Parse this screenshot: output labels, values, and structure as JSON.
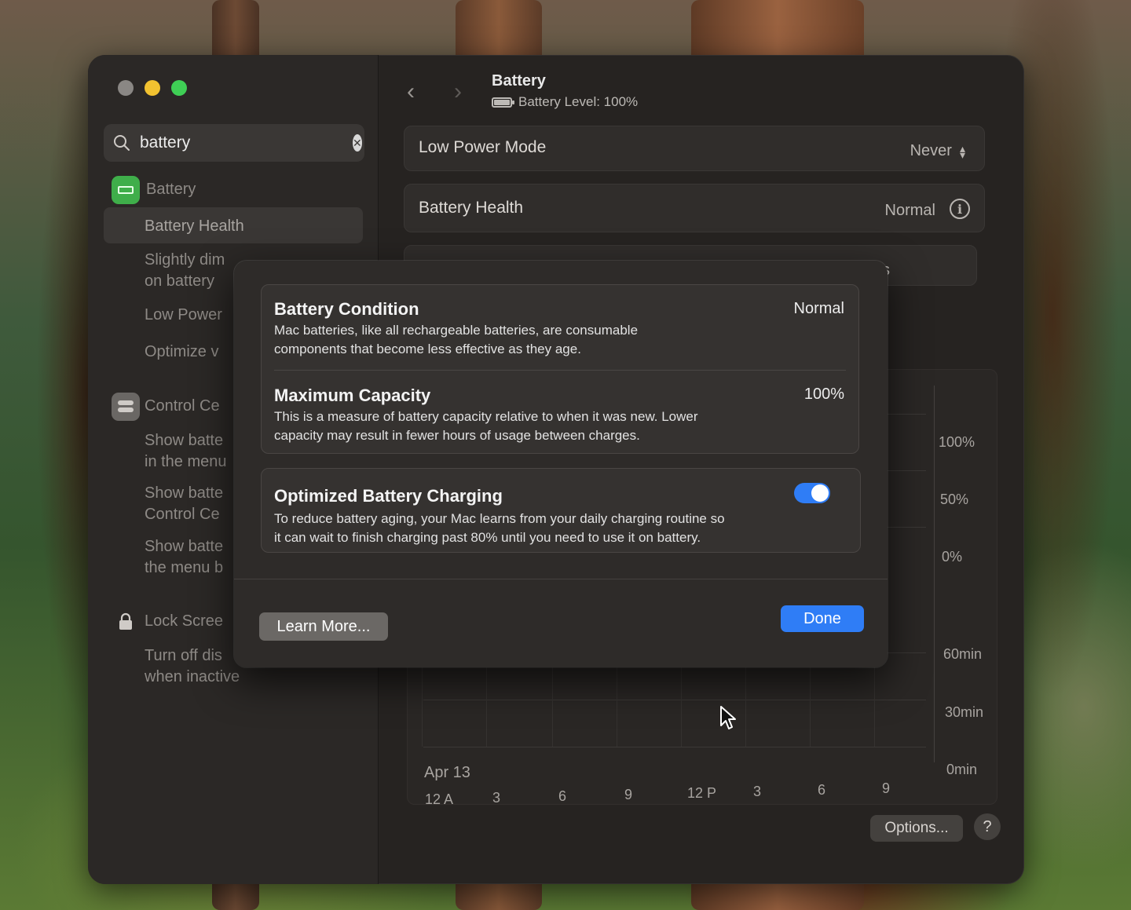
{
  "sidebar": {
    "search": {
      "value": "battery"
    },
    "results": [
      {
        "label": "Battery"
      },
      {
        "label": "Battery Health"
      },
      {
        "label_line1": "Slightly dim",
        "label_line2": "on battery"
      },
      {
        "label": "Low Power"
      },
      {
        "label": "Optimize v"
      },
      {
        "label": "Control Ce"
      },
      {
        "label_line1": "Show batte",
        "label_line2": "in the menu"
      },
      {
        "label_line1": "Show batte",
        "label_line2": "Control Ce"
      },
      {
        "label_line1": "Show batte",
        "label_line2": "the menu b"
      },
      {
        "label": "Lock Scree"
      },
      {
        "label_line1": "Turn off dis",
        "label_line2": "when inactive"
      }
    ]
  },
  "header": {
    "title": "Battery",
    "subtitle": "Battery Level: 100%"
  },
  "settings": {
    "low_power_mode": {
      "label": "Low Power Mode",
      "value": "Never"
    },
    "battery_health": {
      "label": "Battery Health",
      "value": "Normal"
    },
    "hidden_row_fragment": "s"
  },
  "chart": {
    "level_ticks": [
      "100%",
      "50%",
      "0%"
    ],
    "time_ticks": [
      "60min",
      "30min",
      "0min"
    ],
    "x_ticks": [
      "12 A",
      "3",
      "6",
      "9",
      "12 P",
      "3",
      "6",
      "9"
    ],
    "date_label": "Apr 13"
  },
  "footer": {
    "options_label": "Options...",
    "help_label": "?"
  },
  "modal": {
    "condition": {
      "title": "Battery Condition",
      "value": "Normal",
      "desc_line1": "Mac batteries, like all rechargeable batteries, are consumable",
      "desc_line2": "components that become less effective as they age."
    },
    "capacity": {
      "title": "Maximum Capacity",
      "value": "100%",
      "desc_line1": "This is a measure of battery capacity relative to when it was new. Lower",
      "desc_line2": "capacity may result in fewer hours of usage between charges."
    },
    "optimized": {
      "title": "Optimized Battery Charging",
      "enabled": true,
      "desc_line1": "To reduce battery aging, your Mac learns from your daily charging routine so",
      "desc_line2": "it can wait to finish charging past 80% until you need to use it on battery."
    },
    "learn_more_label": "Learn More...",
    "done_label": "Done"
  },
  "colors": {
    "accent": "#2f7df6",
    "close": "#8a8784",
    "minimize": "#f2c230",
    "zoom": "#3fcf55",
    "battery_icon_green": "#3fae4a"
  }
}
